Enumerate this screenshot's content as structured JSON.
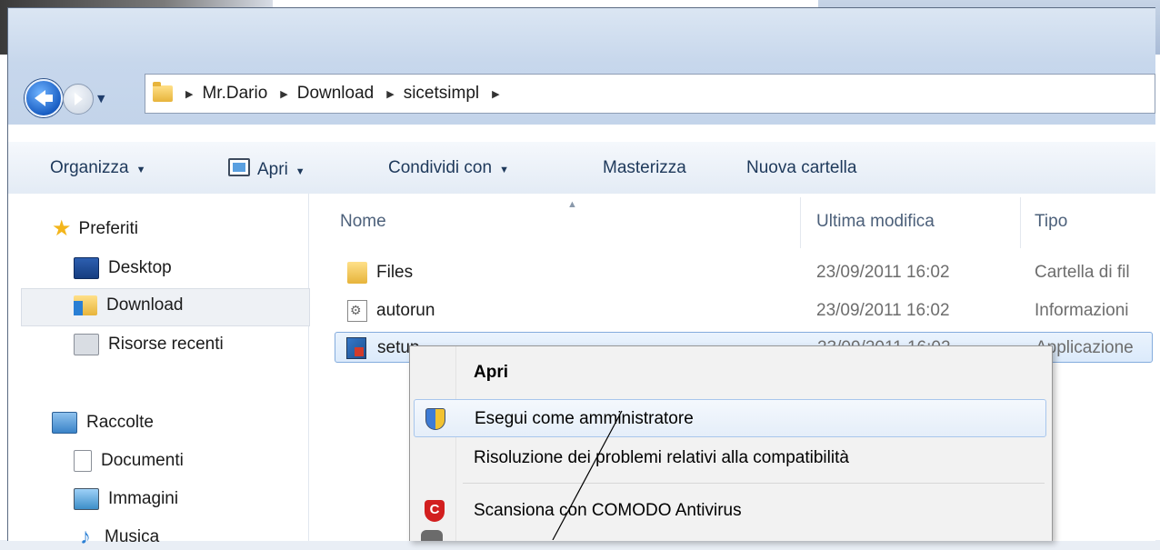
{
  "address": {
    "breadcrumbs": [
      "Mr.Dario",
      "Download",
      "sicetsimpl"
    ]
  },
  "toolbar": {
    "organize": "Organizza",
    "open": "Apri",
    "share": "Condividi con",
    "burn": "Masterizza",
    "new_folder": "Nuova cartella"
  },
  "nav": {
    "favorites": "Preferiti",
    "desktop": "Desktop",
    "download": "Download",
    "recent": "Risorse recenti",
    "libraries": "Raccolte",
    "documents": "Documenti",
    "images": "Immagini",
    "music": "Musica"
  },
  "columns": {
    "name": "Nome",
    "modified": "Ultima modifica",
    "type": "Tipo"
  },
  "files": [
    {
      "name": "Files",
      "modified": "23/09/2011 16:02",
      "type": "Cartella di fil",
      "icon": "folder-icon"
    },
    {
      "name": "autorun",
      "modified": "23/09/2011 16:02",
      "type": "Informazioni",
      "icon": "setup-information-icon"
    },
    {
      "name": "setup",
      "modified": "23/09/2011 16:02",
      "type": "Applicazione",
      "icon": "application-icon",
      "selected": true
    }
  ],
  "context_menu": {
    "open": "Apri",
    "run_as_admin": "Esegui come amministratore",
    "compat": "Risoluzione dei problemi relativi alla compatibilità",
    "scan": "Scansiona con COMODO Antivirus"
  },
  "colors": {
    "toolbar_text": "#1e395b",
    "selection_border": "#84acdd",
    "menu_hover_border": "#a8c6ec",
    "comodo_red": "#d21f1f"
  }
}
